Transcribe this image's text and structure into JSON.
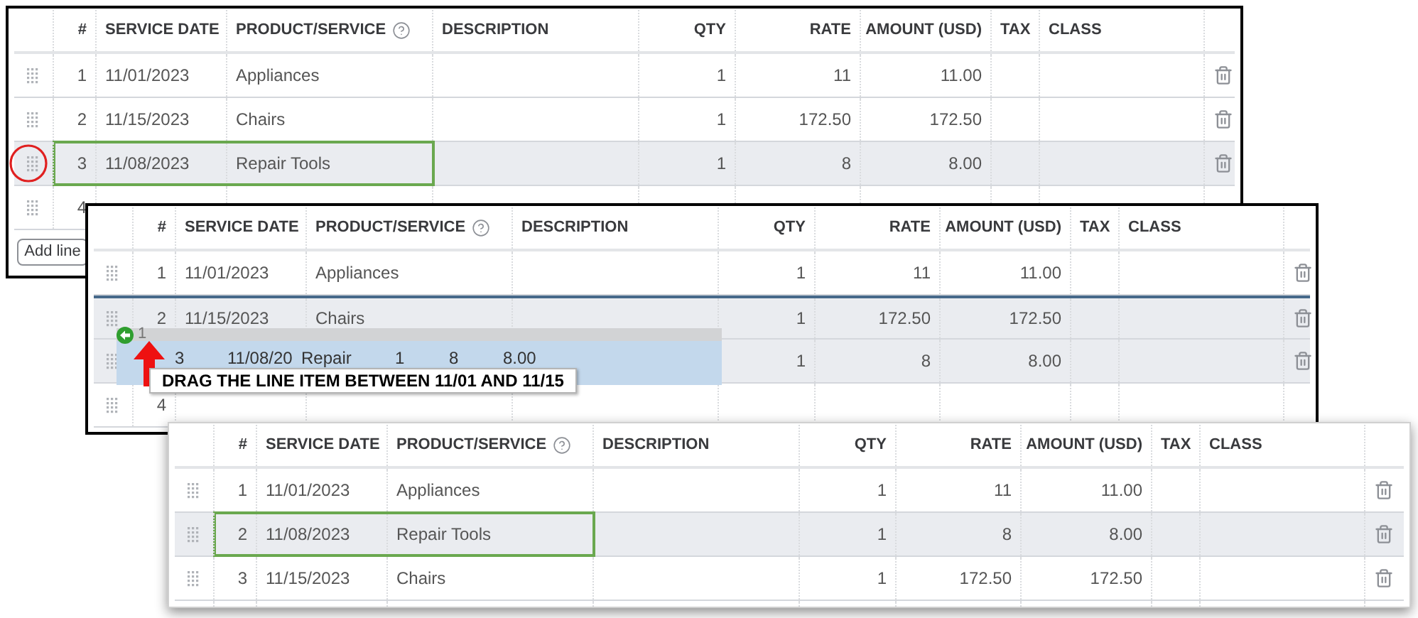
{
  "panels": [
    {
      "kind": "framed",
      "columns": [
        {
          "label": "#",
          "help": false
        },
        {
          "label": "SERVICE DATE",
          "help": false
        },
        {
          "label": "PRODUCT/SERVICE",
          "help": true
        },
        {
          "label": "DESCRIPTION",
          "help": false
        },
        {
          "label": "QTY",
          "help": false
        },
        {
          "label": "RATE",
          "help": false
        },
        {
          "label": "AMOUNT (USD)",
          "help": false
        },
        {
          "label": "TAX",
          "help": false
        },
        {
          "label": "CLASS",
          "help": false
        }
      ],
      "rows": [
        {
          "num": "1",
          "date": "11/01/2023",
          "product": "Appliances",
          "qty": "1",
          "rate": "11",
          "amount": "11.00",
          "highlighted": false,
          "outlined": false,
          "circled": false,
          "drop_line": false
        },
        {
          "num": "2",
          "date": "11/15/2023",
          "product": "Chairs",
          "qty": "1",
          "rate": "172.50",
          "amount": "172.50",
          "highlighted": false,
          "outlined": false,
          "circled": false,
          "drop_line": false
        },
        {
          "num": "3",
          "date": "11/08/2023",
          "product": "Repair Tools",
          "qty": "1",
          "rate": "8",
          "amount": "8.00",
          "highlighted": true,
          "outlined": true,
          "circled": true,
          "drop_line": false
        },
        {
          "num": "4",
          "highlighted": false,
          "outlined": false,
          "circled": false,
          "drop_line": false
        }
      ],
      "add_line_button": "Add line"
    },
    {
      "kind": "framed",
      "columns": [
        {
          "label": "#",
          "help": false
        },
        {
          "label": "SERVICE DATE",
          "help": false
        },
        {
          "label": "PRODUCT/SERVICE",
          "help": true
        },
        {
          "label": "DESCRIPTION",
          "help": false
        },
        {
          "label": "QTY",
          "help": false
        },
        {
          "label": "RATE",
          "help": false
        },
        {
          "label": "AMOUNT (USD)",
          "help": false
        },
        {
          "label": "TAX",
          "help": false
        },
        {
          "label": "CLASS",
          "help": false
        }
      ],
      "rows": [
        {
          "num": "1",
          "date": "11/01/2023",
          "product": "Appliances",
          "qty": "1",
          "rate": "11",
          "amount": "11.00",
          "highlighted": false,
          "outlined": false,
          "circled": false,
          "drop_line": false
        },
        {
          "num": "2",
          "date": "11/15/2023",
          "product": "Chairs",
          "qty": "1",
          "rate": "172.50",
          "amount": "172.50",
          "highlighted": true,
          "outlined": false,
          "circled": false,
          "drop_line": true
        },
        {
          "qty": "1",
          "rate": "8",
          "amount": "8.00",
          "highlighted": true,
          "outlined": false,
          "circled": false,
          "drop_line": false
        },
        {
          "num": "4",
          "highlighted": false,
          "outlined": false,
          "circled": false,
          "drop_line": false
        }
      ],
      "drag_ghost": {
        "strip_label": "1",
        "cells": [
          "3",
          "11/08/20",
          "Repair",
          "1",
          "8",
          "8.00"
        ]
      },
      "callout": "DRAG THE LINE ITEM BETWEEN 11/01 AND 11/15"
    },
    {
      "kind": "floating",
      "columns": [
        {
          "label": "#",
          "help": false
        },
        {
          "label": "SERVICE DATE",
          "help": false
        },
        {
          "label": "PRODUCT/SERVICE",
          "help": true
        },
        {
          "label": "DESCRIPTION",
          "help": false
        },
        {
          "label": "QTY",
          "help": false
        },
        {
          "label": "RATE",
          "help": false
        },
        {
          "label": "AMOUNT (USD)",
          "help": false
        },
        {
          "label": "TAX",
          "help": false
        },
        {
          "label": "CLASS",
          "help": false
        }
      ],
      "rows": [
        {
          "num": "1",
          "date": "11/01/2023",
          "product": "Appliances",
          "qty": "1",
          "rate": "11",
          "amount": "11.00",
          "highlighted": false,
          "outlined": false,
          "circled": false,
          "drop_line": false
        },
        {
          "num": "2",
          "date": "11/08/2023",
          "product": "Repair Tools",
          "qty": "1",
          "rate": "8",
          "amount": "8.00",
          "highlighted": true,
          "outlined": true,
          "circled": false,
          "drop_line": false
        },
        {
          "num": "3",
          "date": "11/15/2023",
          "product": "Chairs",
          "qty": "1",
          "rate": "172.50",
          "amount": "172.50",
          "highlighted": false,
          "outlined": false,
          "circled": false,
          "drop_line": false
        },
        {
          "highlighted": false,
          "outlined": false,
          "circled": false,
          "drop_line": false
        }
      ]
    }
  ]
}
